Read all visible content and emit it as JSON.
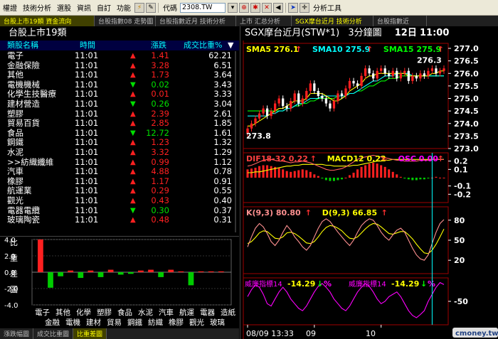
{
  "menubar": {
    "items": [
      "權證",
      "技術分析",
      "選股",
      "資訊",
      "自訂",
      "功能"
    ],
    "code_label": "代碼",
    "code_value": "2308.TW",
    "analysis_tools": "分析工具"
  },
  "tabs": [
    {
      "label": "台股上市19類 資金流向",
      "active": true
    },
    {
      "label": "台股指數08 走勢圖",
      "active": false
    },
    {
      "label": "台股指數近月 技術分析",
      "active": false
    },
    {
      "label": "上市 汇总分析",
      "active": false
    },
    {
      "label": "SGX摩台近月 技術分析",
      "active": true
    },
    {
      "label": "台股指數近",
      "active": false
    }
  ],
  "left": {
    "title": "台股上市19類",
    "headers": {
      "name": "類股名稱",
      "time": "時間",
      "change": "漲跌",
      "pct": "成交比重%"
    },
    "rows": [
      {
        "name": "電子",
        "time": "11:01",
        "dir": "up",
        "change": "1.41",
        "pct": "62.21"
      },
      {
        "name": "金融保險",
        "time": "11:01",
        "dir": "up",
        "change": "3.28",
        "pct": "6.51"
      },
      {
        "name": "其他",
        "time": "11:01",
        "dir": "up",
        "change": "1.73",
        "pct": "3.64"
      },
      {
        "name": "電機機械",
        "time": "11:01",
        "dir": "dn",
        "change": "0.02",
        "pct": "3.43"
      },
      {
        "name": "化學生技醫療",
        "time": "11:01",
        "dir": "up",
        "change": "0.01",
        "pct": "3.33"
      },
      {
        "name": "建材營造",
        "time": "11:01",
        "dir": "dn",
        "change": "0.26",
        "pct": "3.04"
      },
      {
        "name": "塑膠",
        "time": "11:01",
        "dir": "up",
        "change": "2.39",
        "pct": "2.61"
      },
      {
        "name": "貿易百貨",
        "time": "11:01",
        "dir": "up",
        "change": "2.85",
        "pct": "1.85"
      },
      {
        "name": "食品",
        "time": "11:01",
        "dir": "dn",
        "change": "12.72",
        "pct": "1.61"
      },
      {
        "name": "鋼鐵",
        "time": "11:01",
        "dir": "up",
        "change": "1.23",
        "pct": "1.32"
      },
      {
        "name": "水泥",
        "time": "11:01",
        "dir": "up",
        "change": "3.32",
        "pct": "1.29"
      },
      {
        "name": ">>紡織纖維",
        "time": "11:01",
        "dir": "up",
        "change": "0.99",
        "pct": "1.12"
      },
      {
        "name": "汽車",
        "time": "11:01",
        "dir": "up",
        "change": "4.88",
        "pct": "0.78"
      },
      {
        "name": "橡膠",
        "time": "11:01",
        "dir": "up",
        "change": "1.17",
        "pct": "0.91"
      },
      {
        "name": "航運業",
        "time": "11:01",
        "dir": "up",
        "change": "0.29",
        "pct": "0.55"
      },
      {
        "name": "觀光",
        "time": "11:01",
        "dir": "up",
        "change": "0.43",
        "pct": "0.40"
      },
      {
        "name": "電器電纜",
        "time": "11:01",
        "dir": "dn",
        "change": "0.30",
        "pct": "0.37"
      },
      {
        "name": "玻璃陶瓷",
        "time": "11:01",
        "dir": "up",
        "change": "0.48",
        "pct": "0.31"
      }
    ]
  },
  "lower_tabs": [
    {
      "label": "漲跌幅圖",
      "active": false
    },
    {
      "label": "成交比重圖",
      "active": false
    },
    {
      "label": "比重差圖",
      "active": true
    }
  ],
  "right": {
    "title": "SGX摩台近月(STW*1)",
    "period": "3分鐘圖",
    "date": "12日",
    "time": "11:00"
  },
  "chart_data": [
    {
      "type": "bar",
      "ylabel": "比重差圖",
      "ylim": [
        -4.0,
        4.0
      ],
      "yticks": [
        "4.0",
        "2.0",
        "0.0",
        "-2.0",
        "-4.0"
      ],
      "categories_top": [
        "電子",
        "其他",
        "化學",
        "塑膠",
        "食品",
        "水泥",
        "汽車",
        "航運",
        "電器",
        "造紙"
      ],
      "categories_bottom": [
        "金融",
        "電機",
        "建材",
        "貿易",
        "鋼鐵",
        "紡織",
        "橡膠",
        "觀光",
        "玻璃"
      ],
      "values": [
        4.0,
        -1.9,
        -0.5,
        0.2,
        -0.7,
        0.2,
        -0.6,
        0.3,
        -0.3,
        -0.2,
        0.2,
        0.3,
        -0.6,
        0.3,
        0.1,
        -1.6,
        0.1,
        0.1,
        0.1
      ],
      "colors": {
        "pos": "#ff2020",
        "neg": "#00cc00"
      }
    },
    {
      "type": "candlestick",
      "legend": [
        {
          "name": "SMA5",
          "value": "276.1",
          "arrow": "↑",
          "color": "#ffff00"
        },
        {
          "name": "SMA10",
          "value": "275.9",
          "arrow": "↑",
          "color": "#00ffff"
        },
        {
          "name": "SMA15",
          "value": "275.9",
          "arrow": "↑",
          "color": "#00ff00"
        }
      ],
      "ylim": [
        273.0,
        277.2
      ],
      "yticks": [
        "277.0",
        "276.5",
        "276.0",
        "275.5",
        "275.0",
        "274.5",
        "274.0",
        "273.5",
        "273.0"
      ],
      "high_label": "276.3",
      "low_label": "273.8",
      "close": [
        273.8,
        274.0,
        274.2,
        274.4,
        274.6,
        274.3,
        274.5,
        274.8,
        275.0,
        274.7,
        274.6,
        274.9,
        275.2,
        274.8,
        275.0,
        275.3,
        275.6,
        275.3,
        275.1,
        275.0,
        274.8,
        274.6,
        274.9,
        275.2,
        275.1,
        275.4,
        275.7,
        275.6,
        275.5,
        275.9,
        276.2,
        276.0,
        275.8,
        276.1,
        276.2,
        276.0,
        275.9,
        276.1,
        275.8,
        276.0,
        276.1,
        275.7,
        275.9,
        275.8,
        276.0,
        275.9,
        276.1,
        276.2,
        276.0,
        276.1,
        276.2
      ],
      "sma5": [
        273.9,
        273.9,
        274.0,
        274.1,
        274.2,
        274.3,
        274.4,
        274.5,
        274.6,
        274.6,
        274.7,
        274.8,
        274.9,
        274.9,
        274.9,
        275.0,
        275.2,
        275.2,
        275.2,
        275.2,
        275.1,
        275.0,
        274.9,
        274.9,
        275.0,
        275.1,
        275.3,
        275.4,
        275.5,
        275.6,
        275.8,
        275.9,
        275.9,
        276.0,
        276.0,
        276.0,
        276.0,
        276.0,
        276.0,
        276.0,
        276.0,
        275.9,
        275.9,
        275.9,
        275.9,
        275.9,
        275.9,
        276.0,
        276.0,
        276.1,
        276.1
      ],
      "sma10": [
        274.3,
        274.3,
        274.3,
        274.3,
        274.3,
        274.3,
        274.4,
        274.4,
        274.5,
        274.5,
        274.6,
        274.6,
        274.7,
        274.8,
        274.8,
        274.9,
        275.0,
        275.0,
        275.0,
        275.1,
        275.1,
        275.1,
        275.1,
        275.1,
        275.1,
        275.1,
        275.2,
        275.2,
        275.3,
        275.4,
        275.5,
        275.6,
        275.7,
        275.7,
        275.8,
        275.9,
        275.9,
        275.9,
        276.0,
        276.0,
        276.0,
        276.0,
        275.9,
        275.9,
        275.9,
        275.9,
        275.9,
        275.9,
        275.9,
        275.9,
        275.9
      ],
      "sma15": [
        274.5,
        274.5,
        274.5,
        274.5,
        274.5,
        274.5,
        274.5,
        274.5,
        274.5,
        274.5,
        274.6,
        274.6,
        274.7,
        274.7,
        274.8,
        274.8,
        274.9,
        274.9,
        275.0,
        275.0,
        275.0,
        275.0,
        275.0,
        275.1,
        275.1,
        275.1,
        275.2,
        275.2,
        275.3,
        275.3,
        275.4,
        275.5,
        275.5,
        275.6,
        275.7,
        275.7,
        275.8,
        275.8,
        275.8,
        275.9,
        275.9,
        275.9,
        275.9,
        275.9,
        275.9,
        275.9,
        275.9,
        275.9,
        275.9,
        275.9,
        275.9
      ]
    },
    {
      "type": "bar",
      "legend": [
        {
          "name": "DIF18-32",
          "value": "0.22",
          "arrow": "↑",
          "color": "#ff4040"
        },
        {
          "name": "MACD12",
          "value": "0.22",
          "arrow": "=",
          "color": "#ffff00"
        },
        {
          "name": "OSC",
          "value": "0.00",
          "arrow": "↑",
          "color": "#ff00ff"
        }
      ],
      "ylim": [
        -0.3,
        0.3
      ],
      "yticks": [
        "0.2",
        "0.1",
        "-0.1",
        "-0.2"
      ],
      "osc": [
        0.1,
        0.11,
        0.12,
        0.14,
        0.15,
        0.15,
        0.14,
        0.13,
        0.12,
        0.1,
        0.08,
        0.07,
        0.08,
        0.09,
        0.1,
        0.09,
        0.07,
        0.04,
        0.02,
        -0.01,
        -0.03,
        -0.04,
        -0.04,
        -0.03,
        -0.02,
        0.0,
        0.03,
        0.06,
        0.1,
        0.13,
        0.15,
        0.17,
        0.18,
        0.17,
        0.15,
        0.13,
        0.1,
        0.07,
        0.04,
        0.01,
        -0.01,
        -0.02,
        -0.03,
        -0.03,
        -0.02,
        -0.02,
        -0.01,
        0.0,
        0.01,
        0.0,
        0.0
      ],
      "dif": [
        0.14,
        0.15,
        0.17,
        0.19,
        0.21,
        0.22,
        0.22,
        0.21,
        0.2,
        0.2,
        0.19,
        0.18,
        0.19,
        0.19,
        0.2,
        0.19,
        0.18,
        0.16,
        0.14,
        0.12,
        0.1,
        0.09,
        0.09,
        0.1,
        0.11,
        0.13,
        0.16,
        0.19,
        0.22,
        0.24,
        0.25,
        0.26,
        0.27,
        0.26,
        0.25,
        0.24,
        0.23,
        0.22,
        0.21,
        0.21,
        0.2,
        0.2,
        0.2,
        0.2,
        0.21,
        0.21,
        0.21,
        0.22,
        0.22,
        0.22,
        0.22
      ],
      "macd": [
        0.06,
        0.06,
        0.07,
        0.07,
        0.08,
        0.09,
        0.1,
        0.11,
        0.12,
        0.13,
        0.14,
        0.14,
        0.15,
        0.15,
        0.16,
        0.16,
        0.16,
        0.16,
        0.16,
        0.16,
        0.15,
        0.15,
        0.14,
        0.14,
        0.14,
        0.14,
        0.14,
        0.15,
        0.15,
        0.16,
        0.17,
        0.18,
        0.19,
        0.2,
        0.2,
        0.21,
        0.21,
        0.22,
        0.22,
        0.22,
        0.22,
        0.22,
        0.22,
        0.22,
        0.22,
        0.22,
        0.22,
        0.22,
        0.22,
        0.22,
        0.22
      ]
    },
    {
      "type": "line",
      "legend": [
        {
          "name": "K(9,3)",
          "value": "80.80",
          "arrow": "↑",
          "color": "#ff9090"
        },
        {
          "name": "D(9,3)",
          "value": "66.85",
          "arrow": "↑",
          "color": "#ffff00"
        }
      ],
      "ylim": [
        0,
        100
      ],
      "yticks": [
        "80",
        "50",
        "20"
      ],
      "k": [
        40,
        55,
        68,
        75,
        70,
        60,
        48,
        42,
        50,
        62,
        72,
        65,
        55,
        48,
        40,
        35,
        42,
        55,
        68,
        78,
        82,
        78,
        70,
        62,
        55,
        48,
        42,
        50,
        62,
        72,
        78,
        82,
        80,
        72,
        62,
        55,
        50,
        58,
        65,
        68,
        62,
        50,
        38,
        28,
        22,
        20,
        28,
        45,
        62,
        75,
        80.8
      ],
      "d": [
        45,
        48,
        54,
        61,
        64,
        63,
        58,
        53,
        52,
        55,
        61,
        62,
        60,
        56,
        51,
        46,
        45,
        48,
        55,
        63,
        69,
        72,
        71,
        68,
        64,
        58,
        53,
        52,
        55,
        61,
        67,
        72,
        75,
        74,
        70,
        65,
        60,
        59,
        61,
        63,
        63,
        58,
        52,
        44,
        37,
        31,
        30,
        35,
        44,
        55,
        66.85
      ]
    },
    {
      "type": "line",
      "legend": [
        {
          "name": "威廉指標14",
          "value": "-14.29",
          "arrow": "↓",
          "suffix": "%",
          "color": "#ff00ff"
        },
        {
          "name": "威廉指標14",
          "value": "-14.29",
          "arrow": "↓",
          "suffix": "%",
          "color": "#ff00ff"
        }
      ],
      "ylim": [
        -100,
        0
      ],
      "yticks": [
        "-50"
      ],
      "wr": [
        -40,
        -25,
        -15,
        -20,
        -35,
        -55,
        -60,
        -45,
        -30,
        -20,
        -30,
        -45,
        -55,
        -65,
        -70,
        -60,
        -45,
        -30,
        -18,
        -12,
        -20,
        -30,
        -45,
        -55,
        -65,
        -70,
        -60,
        -45,
        -30,
        -20,
        -12,
        -18,
        -30,
        -45,
        -55,
        -50,
        -40,
        -35,
        -30,
        -40,
        -55,
        -70,
        -80,
        -85,
        -78,
        -70,
        -50,
        -35,
        -20,
        -10,
        -14.29
      ]
    }
  ],
  "x_axis": {
    "labels": [
      "08/09 13:33",
      "09",
      "10"
    ]
  },
  "watermark": "cmoney.tw"
}
